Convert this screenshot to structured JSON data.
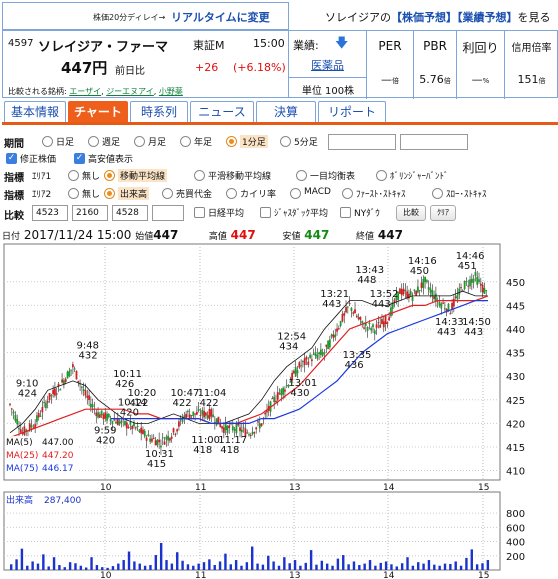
{
  "header": {
    "delay_note": "株価20分ディレイ→",
    "realtime_link": "リアルタイムに変更",
    "top_right_prefix": "ソレイジアの",
    "top_right_link1": "【株価予想】",
    "top_right_link2": "【業績予想】",
    "top_right_suffix": "を見る"
  },
  "stock": {
    "code": "4597",
    "name": "ソレイジア・ファーマ",
    "market": "東証M",
    "time": "15:00",
    "price": "447円",
    "prev_label": "前日比",
    "change": "+26",
    "change_pct": "(+6.18%)",
    "compared_label": "比較される銘柄:",
    "compared": [
      "エーザイ",
      "ジーエヌアイ",
      "小野薬"
    ]
  },
  "metrics": {
    "gyoseki_label": "業績:",
    "industry": "医薬品",
    "unit": "単位 100株",
    "per_label": "PER",
    "per_value": "—",
    "per_unit": "倍",
    "pbr_label": "PBR",
    "pbr_value": "5.76",
    "pbr_unit": "倍",
    "yield_label": "利回り",
    "yield_value": "—",
    "yield_unit": "%",
    "margin_label": "信用倍率",
    "margin_value": "151",
    "margin_unit": "倍"
  },
  "tabs": [
    "基本情報",
    "チャート",
    "時系列",
    "ニュース",
    "決算",
    "リポート"
  ],
  "controls": {
    "period_label": "期間",
    "periods": [
      "日足",
      "週足",
      "月足",
      "年足",
      "1分足",
      "5分足"
    ],
    "selected_period": "1分足",
    "checks": [
      "修正株価",
      "高安値表示"
    ],
    "ind1_label": "指標",
    "ind1_area": "ｴﾘｱ1",
    "ind1_options": [
      "無し",
      "移動平均線",
      "平滑移動平均線",
      "一目均衡表",
      "ﾎﾞﾘﾝｼﾞｬｰﾊﾞﾝﾄﾞ"
    ],
    "ind1_selected": "移動平均線",
    "ind2_label": "指標",
    "ind2_area": "ｴﾘｱ2",
    "ind2_options": [
      "無し",
      "出来高",
      "売買代金",
      "カイリ率",
      "MACD",
      "ﾌｧｰｽﾄ･ｽﾄｷｬｽ",
      "ｽﾛｰ･ｽﾄｷｬｽ"
    ],
    "ind2_selected": "出来高",
    "compare_label": "比較",
    "compare_codes": [
      "4523",
      "2160",
      "4528",
      ""
    ],
    "compare_checks": [
      "日経平均",
      "ｼﾞｬｽﾀﾞｯｸ平均",
      "NYﾀﾞｳ"
    ],
    "compare_button": "比較",
    "clear_button": "ｸﾘｱ"
  },
  "chart_info": {
    "date_label": "日付",
    "date": "2017/11/24 15:00",
    "open_label": "始値",
    "open": "447",
    "high_label": "高値",
    "high": "447",
    "low_label": "安値",
    "low": "447",
    "close_label": "終値",
    "close": "447"
  },
  "colors": {
    "up_candle": "#d21f1f",
    "down_candle": "#1f9a2a",
    "ma5": "#111111",
    "ma25": "#e02020",
    "ma75": "#1a3ae0",
    "volume": "#1a33cc",
    "tab_active": "#ee5f1c"
  },
  "chart_data": [
    {
      "type": "line",
      "title": "",
      "x_ticks": [
        "10",
        "11",
        "13",
        "14",
        "15"
      ],
      "y_ticks": [
        410,
        415,
        420,
        425,
        430,
        435,
        440,
        445,
        450
      ],
      "ylim": [
        408,
        458
      ],
      "grid": true,
      "legend_position": "bottom-left",
      "series": [
        {
          "name": "MA(5)",
          "legend_value": "447.00",
          "values": [
            418,
            420,
            423,
            427,
            428,
            429,
            428,
            425,
            423,
            421,
            420,
            420,
            421,
            422,
            421,
            420,
            420,
            420,
            421,
            422,
            425,
            429,
            432,
            434,
            436,
            440,
            443,
            446,
            446,
            445,
            445,
            446,
            447,
            447,
            447,
            447,
            448,
            447,
            447
          ]
        },
        {
          "name": "MA(25)",
          "legend_value": "447.20",
          "values": [
            417,
            418,
            419,
            420,
            421,
            422,
            423,
            423,
            423,
            423,
            422,
            422,
            421,
            421,
            421,
            421,
            420,
            420,
            420,
            421,
            422,
            424,
            426,
            428,
            431,
            434,
            437,
            440,
            441,
            442,
            443,
            444,
            445,
            445,
            446,
            446,
            446,
            446,
            447
          ]
        },
        {
          "name": "MA(75)",
          "legend_value": "446.17",
          "values": [
            null,
            null,
            null,
            null,
            null,
            null,
            null,
            null,
            421,
            421,
            421,
            421,
            421,
            421,
            421,
            421,
            420,
            420,
            420,
            420,
            421,
            421,
            422,
            423,
            425,
            427,
            429,
            432,
            435,
            437,
            439,
            440,
            441,
            442,
            443,
            444,
            445,
            446,
            446
          ]
        }
      ],
      "price_path": [
        424,
        418,
        420,
        425,
        428,
        432,
        426,
        422,
        421,
        420,
        419,
        417,
        416,
        418,
        422,
        422,
        422,
        419,
        419,
        418,
        420,
        425,
        428,
        432,
        434,
        435,
        440,
        445,
        441,
        440,
        442,
        448,
        447,
        450,
        446,
        444,
        449,
        451,
        447
      ],
      "annotations": [
        {
          "label": "9:10",
          "value": "424"
        },
        {
          "label": "9:48",
          "value": "432"
        },
        {
          "label": "9:59",
          "value": "420"
        },
        {
          "label": "10:11",
          "value": "426"
        },
        {
          "label": "10:14",
          "value": "420"
        },
        {
          "label": "10:20",
          "value": "422"
        },
        {
          "label": "10:31",
          "value": "415"
        },
        {
          "label": "10:47",
          "value": "422"
        },
        {
          "label": "11:00",
          "value": "418"
        },
        {
          "label": "11:04",
          "value": "422"
        },
        {
          "label": "11:17",
          "value": "418"
        },
        {
          "label": "12:54",
          "value": "434"
        },
        {
          "label": "13:01",
          "value": "430"
        },
        {
          "label": "13:21",
          "value": "443"
        },
        {
          "label": "13:35",
          "value": "436"
        },
        {
          "label": "13:43",
          "value": "448"
        },
        {
          "label": "13:52",
          "value": "443"
        },
        {
          "label": "14:16",
          "value": "450"
        },
        {
          "label": "14:33",
          "value": "443"
        },
        {
          "label": "14:46",
          "value": "451"
        },
        {
          "label": "14:50",
          "value": "443"
        }
      ]
    },
    {
      "type": "bar",
      "title": "出来高",
      "legend_value": "287,400",
      "y_ticks": [
        200,
        400,
        600,
        800
      ],
      "ylim": [
        0,
        900
      ],
      "x_ticks": [
        "10",
        "11",
        "13",
        "14",
        "15"
      ],
      "values": [
        80,
        150,
        300,
        60,
        120,
        90,
        220,
        50,
        180,
        70,
        40,
        110,
        95,
        60,
        35,
        180,
        70,
        40,
        30,
        55,
        90,
        140,
        260,
        120,
        90,
        60,
        70,
        210,
        380,
        140,
        90,
        250,
        130,
        80,
        60,
        90,
        110,
        150,
        70,
        120,
        230,
        80,
        140,
        60,
        110,
        330,
        90,
        75,
        200,
        120,
        60,
        180,
        95,
        140,
        60,
        100,
        280,
        75,
        130,
        90,
        60,
        160,
        210,
        80,
        120,
        70,
        90,
        140,
        60,
        100,
        120,
        80,
        50,
        95,
        180,
        60,
        110,
        90,
        140,
        75,
        60,
        90,
        85,
        120,
        60,
        170,
        290,
        80,
        95,
        140
      ]
    }
  ]
}
